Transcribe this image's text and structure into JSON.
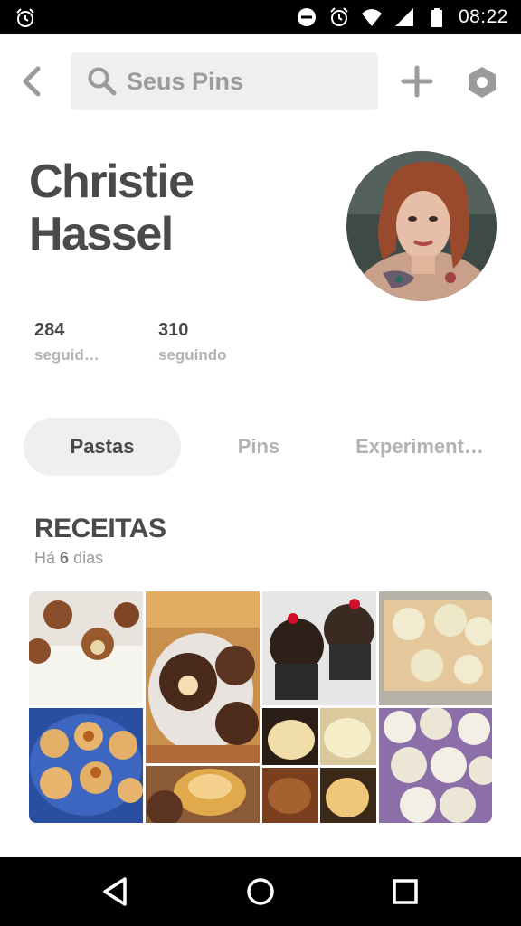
{
  "status_bar": {
    "time": "08:22",
    "icons": [
      "alarm-icon",
      "do-not-disturb-icon",
      "alarm-icon",
      "wifi-icon",
      "signal-icon",
      "battery-icon"
    ]
  },
  "toolbar": {
    "search_placeholder": "Seus Pins",
    "icons": [
      "back-arrow-icon",
      "search-icon",
      "plus-icon",
      "settings-hexagon-icon"
    ]
  },
  "profile": {
    "name_line1": "Christie",
    "name_line2": "Hassel",
    "followers_count": "284",
    "followers_label": "seguid…",
    "following_count": "310",
    "following_label": "seguindo"
  },
  "tabs": [
    {
      "label": "Pastas",
      "active": true
    },
    {
      "label": "Pins",
      "active": false
    },
    {
      "label": "Experiment…",
      "active": false
    }
  ],
  "board": {
    "title": "RECEITAS",
    "meta_prefix": "Há",
    "meta_number": "6",
    "meta_suffix": "dias"
  },
  "colors": {
    "text_dark": "#4a4a4a",
    "text_light": "#b3b3b3",
    "tab_active_bg": "#efefef",
    "search_bg": "#efefef"
  }
}
